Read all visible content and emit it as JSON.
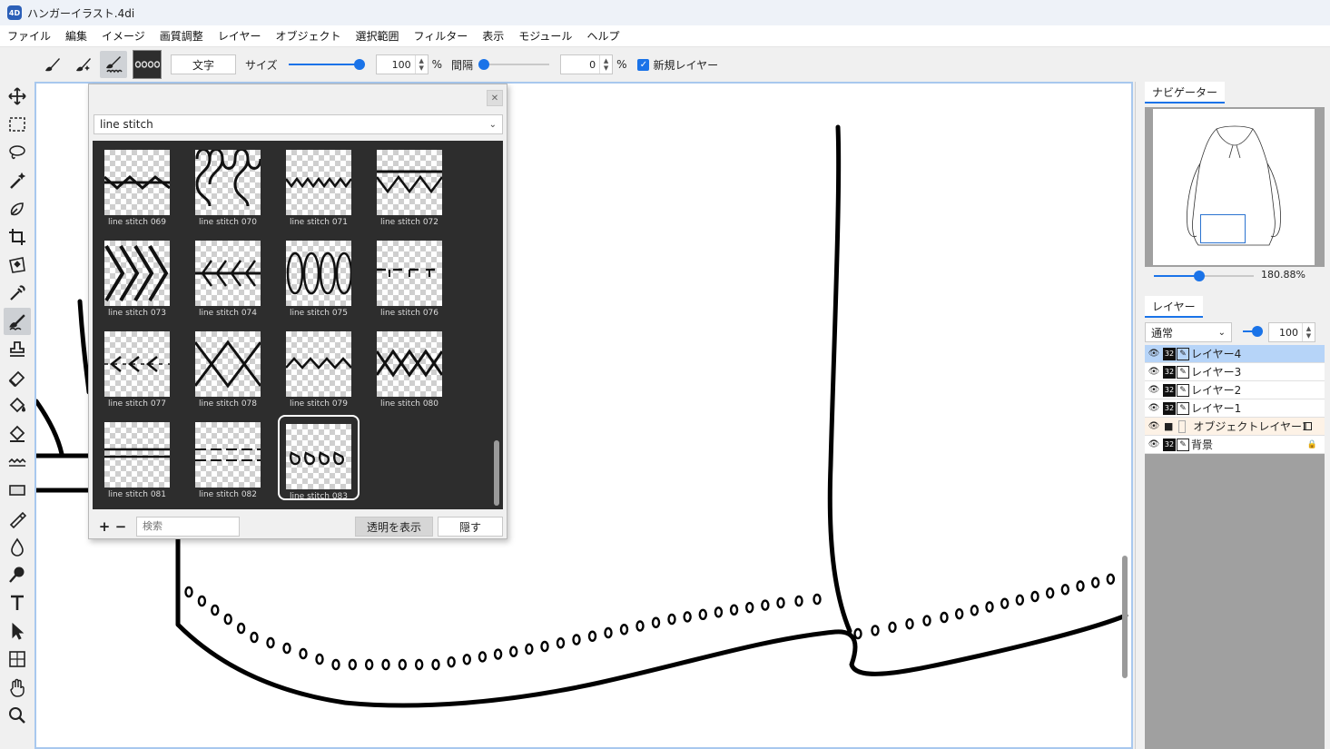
{
  "window": {
    "title": "ハンガーイラスト.4di",
    "app_icon_text": "4D"
  },
  "menu": [
    "ファイル",
    "編集",
    "イメージ",
    "画質調整",
    "レイヤー",
    "オブジェクト",
    "選択範囲",
    "フィルター",
    "表示",
    "モジュール",
    "ヘルプ"
  ],
  "options": {
    "text_button": "文字",
    "size_label": "サイズ",
    "size_value": "100",
    "size_unit": "%",
    "size_level": 1.0,
    "spacing_label": "間隔",
    "spacing_value": "0",
    "spacing_unit": "%",
    "spacing_level": 0.0,
    "new_layer_label": "新規レイヤー",
    "new_layer_checked": true
  },
  "tools": [
    "move-icon",
    "rect-select-icon",
    "lasso-icon",
    "magic-wand-icon",
    "pen-tool-icon",
    "crop-icon",
    "transform-icon",
    "eyedropper-icon",
    "brush-icon",
    "stamp-icon",
    "eraser-icon",
    "fill-bucket-icon",
    "gradient-bucket-icon",
    "pattern-icon",
    "shape-icon",
    "pen-outline-icon",
    "blur-drop-icon",
    "smudge-icon",
    "text-icon",
    "select-arrow-icon",
    "mesh-transform-icon",
    "hand-icon",
    "zoom-icon"
  ],
  "brush_panel": {
    "category": "line stitch",
    "items": [
      {
        "label": "line stitch 069",
        "pattern": "zigzag-line"
      },
      {
        "label": "line stitch 070",
        "pattern": "wave"
      },
      {
        "label": "line stitch 071",
        "pattern": "small-zigzag"
      },
      {
        "label": "line stitch 072",
        "pattern": "zigzag-line-top"
      },
      {
        "label": "line stitch 073",
        "pattern": "chevron"
      },
      {
        "label": "line stitch 074",
        "pattern": "feather"
      },
      {
        "label": "line stitch 075",
        "pattern": "loops"
      },
      {
        "label": "line stitch 076",
        "pattern": "dash-tick"
      },
      {
        "label": "line stitch 077",
        "pattern": "arrows"
      },
      {
        "label": "line stitch 078",
        "pattern": "cross"
      },
      {
        "label": "line stitch 079",
        "pattern": "thin-zigzag"
      },
      {
        "label": "line stitch 080",
        "pattern": "double-cross"
      },
      {
        "label": "line stitch 081",
        "pattern": "double-line"
      },
      {
        "label": "line stitch 082",
        "pattern": "dashed-double"
      },
      {
        "label": "line stitch 083",
        "pattern": "drops"
      }
    ],
    "selected_index": 14,
    "search_placeholder": "検索",
    "show_transparent_label": "透明を表示",
    "hide_label": "隠す"
  },
  "navigator": {
    "tab": "ナビゲーター",
    "zoom_text": "180.88%",
    "zoom_level": 0.45
  },
  "layers": {
    "tab": "レイヤー",
    "blend_mode": "通常",
    "opacity_value": "100",
    "opacity_level": 1.0,
    "items": [
      {
        "name": "レイヤー4",
        "kind": "raster",
        "depth": "32",
        "selected": true
      },
      {
        "name": "レイヤー3",
        "kind": "raster",
        "depth": "32",
        "selected": false
      },
      {
        "name": "レイヤー2",
        "kind": "raster",
        "depth": "32",
        "selected": false
      },
      {
        "name": "レイヤー1",
        "kind": "raster",
        "depth": "32",
        "selected": false
      },
      {
        "name": "オブジェクトレイヤー1",
        "kind": "object",
        "depth": "",
        "selected": false
      },
      {
        "name": "背景",
        "kind": "raster",
        "depth": "32",
        "selected": false,
        "locked": true
      }
    ]
  },
  "colors": {
    "accent": "#1a73e8",
    "panel_bg": "#2d2d2d",
    "selected_layer": "#b6d4f8"
  }
}
